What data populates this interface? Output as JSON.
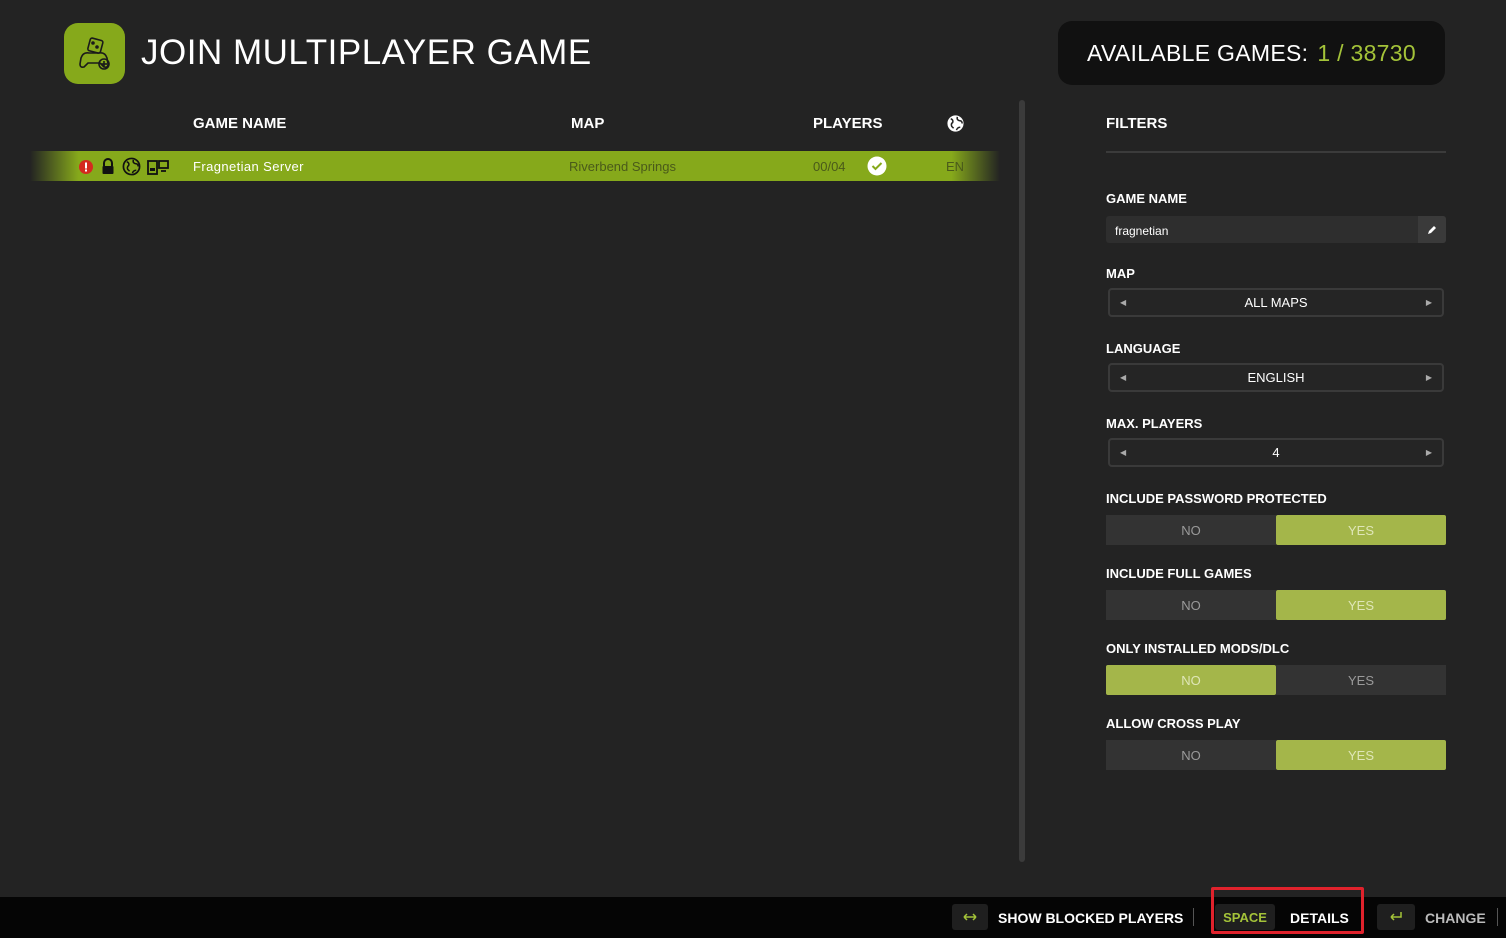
{
  "header": {
    "title": "JOIN MULTIPLAYER GAME",
    "available_label": "AVAILABLE GAMES:",
    "available_count": "1 / 38730"
  },
  "columns": {
    "game_name": "GAME NAME",
    "map": "MAP",
    "players": "PLAYERS",
    "language_icon": "globe-icon"
  },
  "servers": [
    {
      "icons": [
        "warning-icon",
        "lock-icon",
        "globe-icon",
        "platform-icon"
      ],
      "name": "Fragnetian Server",
      "map": "Riverbend Springs",
      "players": "00/04",
      "status_icon": "check-icon",
      "language": "EN"
    }
  ],
  "filters": {
    "title": "FILTERS",
    "game_name": {
      "label": "GAME NAME",
      "value": "fragnetian"
    },
    "map": {
      "label": "MAP",
      "value": "ALL MAPS"
    },
    "language": {
      "label": "LANGUAGE",
      "value": "ENGLISH"
    },
    "max_players": {
      "label": "MAX. PLAYERS",
      "value": "4"
    },
    "password_protected": {
      "label": "INCLUDE PASSWORD PROTECTED",
      "no": "NO",
      "yes": "YES",
      "selected": "YES"
    },
    "full_games": {
      "label": "INCLUDE FULL GAMES",
      "no": "NO",
      "yes": "YES",
      "selected": "YES"
    },
    "installed_mods": {
      "label": "ONLY INSTALLED MODS/DLC",
      "no": "NO",
      "yes": "YES",
      "selected": "NO"
    },
    "cross_play": {
      "label": "ALLOW CROSS PLAY",
      "no": "NO",
      "yes": "YES",
      "selected": "YES"
    }
  },
  "bottom_bar": {
    "show_blocked_key_icon": "left-right-arrow-icon",
    "show_blocked_label": "SHOW BLOCKED PLAYERS",
    "details_key": "SPACE",
    "details_label": "DETAILS",
    "change_key_icon": "enter-icon",
    "change_label": "CHANGE"
  },
  "colors": {
    "accent": "#86a91b",
    "accent_text": "#a4c339",
    "toggle_on": "#a4b64a",
    "background": "#232323",
    "highlight": "#e0222c"
  }
}
